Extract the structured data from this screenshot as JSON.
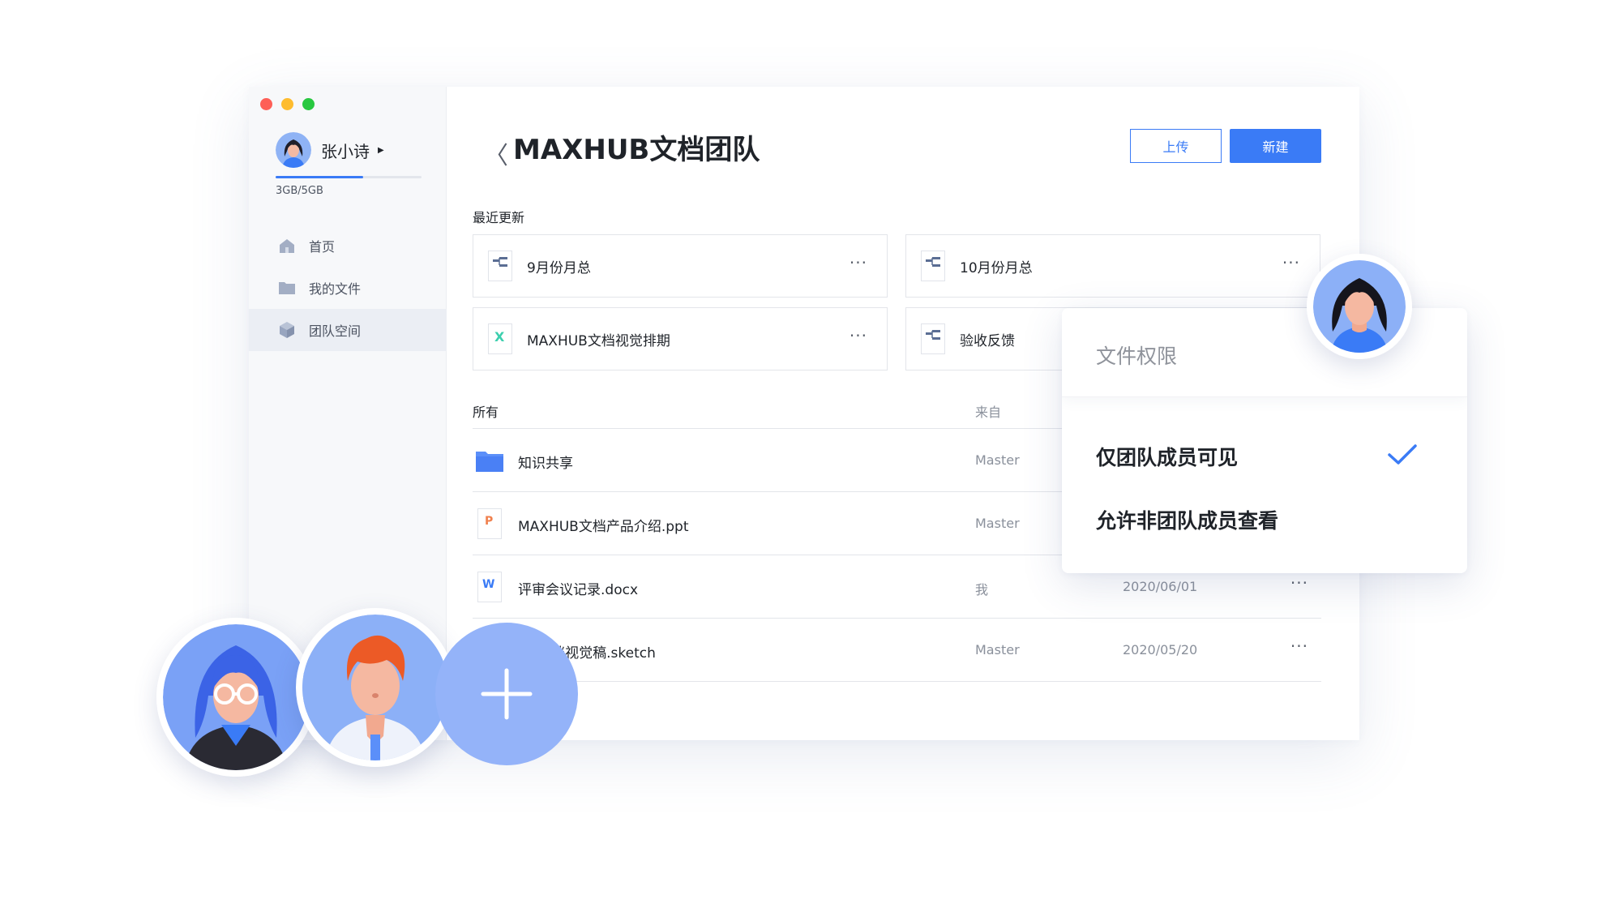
{
  "sidebar": {
    "user_name": "张小诗",
    "storage_text": "3GB/5GB",
    "storage_fraction": 0.6,
    "nav": [
      {
        "label": "首页",
        "icon": "home-icon"
      },
      {
        "label": "我的文件",
        "icon": "folder-icon"
      },
      {
        "label": "团队空间",
        "icon": "cube-icon"
      }
    ]
  },
  "header": {
    "title": "MAXHUB文档团队",
    "upload_label": "上传",
    "new_label": "新建"
  },
  "recent": {
    "label": "最近更新",
    "cards": [
      {
        "name": "9月份月总",
        "icon": "mindmap-file-icon"
      },
      {
        "name": "10月份月总",
        "icon": "mindmap-file-icon"
      },
      {
        "name": "MAXHUB文档视觉排期",
        "icon": "excel-file-icon"
      },
      {
        "name": "验收反馈",
        "icon": "mindmap-file-icon"
      }
    ],
    "more": "···"
  },
  "list": {
    "col_name": "所有",
    "col_from": "来自",
    "rows": [
      {
        "name": "知识共享",
        "from": "Master",
        "date": "",
        "icon": "folder-blue-icon"
      },
      {
        "name": "MAXHUB文档产品介绍.ppt",
        "from": "Master",
        "date": "",
        "icon": "ppt-file-icon"
      },
      {
        "name": "评审会议记录.docx",
        "from": "我",
        "date": "2020/06/01",
        "icon": "word-file-icon"
      },
      {
        "name": "UB文档视觉稿.sketch",
        "from": "Master",
        "date": "2020/05/20",
        "icon": "sketch-file-icon"
      }
    ],
    "more": "···"
  },
  "popup": {
    "title": "文件权限",
    "options": [
      {
        "label": "仅团队成员可见",
        "selected": true
      },
      {
        "label": "允许非团队成员查看",
        "selected": false
      }
    ]
  },
  "colors": {
    "accent": "#3a7bf6",
    "add_circle": "#94b3f9"
  }
}
